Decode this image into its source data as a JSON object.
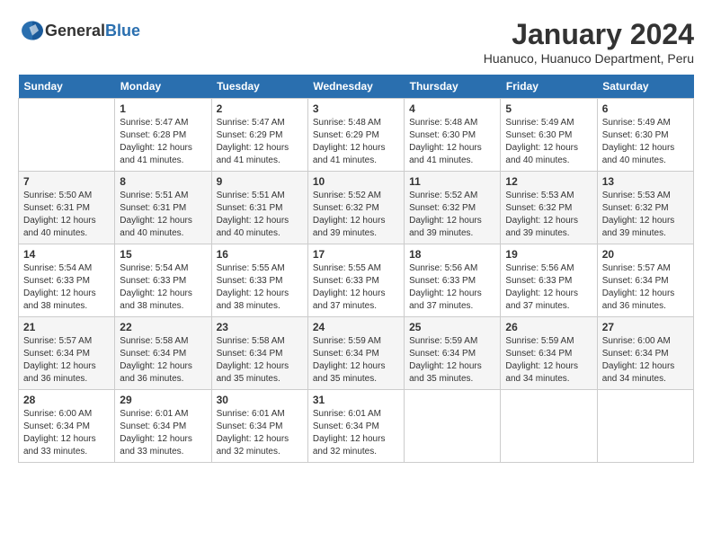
{
  "logo": {
    "general": "General",
    "blue": "Blue"
  },
  "header": {
    "title": "January 2024",
    "subtitle": "Huanuco, Huanuco Department, Peru"
  },
  "days_of_week": [
    "Sunday",
    "Monday",
    "Tuesday",
    "Wednesday",
    "Thursday",
    "Friday",
    "Saturday"
  ],
  "weeks": [
    [
      {
        "day": "",
        "info": ""
      },
      {
        "day": "1",
        "info": "Sunrise: 5:47 AM\nSunset: 6:28 PM\nDaylight: 12 hours\nand 41 minutes."
      },
      {
        "day": "2",
        "info": "Sunrise: 5:47 AM\nSunset: 6:29 PM\nDaylight: 12 hours\nand 41 minutes."
      },
      {
        "day": "3",
        "info": "Sunrise: 5:48 AM\nSunset: 6:29 PM\nDaylight: 12 hours\nand 41 minutes."
      },
      {
        "day": "4",
        "info": "Sunrise: 5:48 AM\nSunset: 6:30 PM\nDaylight: 12 hours\nand 41 minutes."
      },
      {
        "day": "5",
        "info": "Sunrise: 5:49 AM\nSunset: 6:30 PM\nDaylight: 12 hours\nand 40 minutes."
      },
      {
        "day": "6",
        "info": "Sunrise: 5:49 AM\nSunset: 6:30 PM\nDaylight: 12 hours\nand 40 minutes."
      }
    ],
    [
      {
        "day": "7",
        "info": "Sunrise: 5:50 AM\nSunset: 6:31 PM\nDaylight: 12 hours\nand 40 minutes."
      },
      {
        "day": "8",
        "info": "Sunrise: 5:51 AM\nSunset: 6:31 PM\nDaylight: 12 hours\nand 40 minutes."
      },
      {
        "day": "9",
        "info": "Sunrise: 5:51 AM\nSunset: 6:31 PM\nDaylight: 12 hours\nand 40 minutes."
      },
      {
        "day": "10",
        "info": "Sunrise: 5:52 AM\nSunset: 6:32 PM\nDaylight: 12 hours\nand 39 minutes."
      },
      {
        "day": "11",
        "info": "Sunrise: 5:52 AM\nSunset: 6:32 PM\nDaylight: 12 hours\nand 39 minutes."
      },
      {
        "day": "12",
        "info": "Sunrise: 5:53 AM\nSunset: 6:32 PM\nDaylight: 12 hours\nand 39 minutes."
      },
      {
        "day": "13",
        "info": "Sunrise: 5:53 AM\nSunset: 6:32 PM\nDaylight: 12 hours\nand 39 minutes."
      }
    ],
    [
      {
        "day": "14",
        "info": "Sunrise: 5:54 AM\nSunset: 6:33 PM\nDaylight: 12 hours\nand 38 minutes."
      },
      {
        "day": "15",
        "info": "Sunrise: 5:54 AM\nSunset: 6:33 PM\nDaylight: 12 hours\nand 38 minutes."
      },
      {
        "day": "16",
        "info": "Sunrise: 5:55 AM\nSunset: 6:33 PM\nDaylight: 12 hours\nand 38 minutes."
      },
      {
        "day": "17",
        "info": "Sunrise: 5:55 AM\nSunset: 6:33 PM\nDaylight: 12 hours\nand 37 minutes."
      },
      {
        "day": "18",
        "info": "Sunrise: 5:56 AM\nSunset: 6:33 PM\nDaylight: 12 hours\nand 37 minutes."
      },
      {
        "day": "19",
        "info": "Sunrise: 5:56 AM\nSunset: 6:33 PM\nDaylight: 12 hours\nand 37 minutes."
      },
      {
        "day": "20",
        "info": "Sunrise: 5:57 AM\nSunset: 6:34 PM\nDaylight: 12 hours\nand 36 minutes."
      }
    ],
    [
      {
        "day": "21",
        "info": "Sunrise: 5:57 AM\nSunset: 6:34 PM\nDaylight: 12 hours\nand 36 minutes."
      },
      {
        "day": "22",
        "info": "Sunrise: 5:58 AM\nSunset: 6:34 PM\nDaylight: 12 hours\nand 36 minutes."
      },
      {
        "day": "23",
        "info": "Sunrise: 5:58 AM\nSunset: 6:34 PM\nDaylight: 12 hours\nand 35 minutes."
      },
      {
        "day": "24",
        "info": "Sunrise: 5:59 AM\nSunset: 6:34 PM\nDaylight: 12 hours\nand 35 minutes."
      },
      {
        "day": "25",
        "info": "Sunrise: 5:59 AM\nSunset: 6:34 PM\nDaylight: 12 hours\nand 35 minutes."
      },
      {
        "day": "26",
        "info": "Sunrise: 5:59 AM\nSunset: 6:34 PM\nDaylight: 12 hours\nand 34 minutes."
      },
      {
        "day": "27",
        "info": "Sunrise: 6:00 AM\nSunset: 6:34 PM\nDaylight: 12 hours\nand 34 minutes."
      }
    ],
    [
      {
        "day": "28",
        "info": "Sunrise: 6:00 AM\nSunset: 6:34 PM\nDaylight: 12 hours\nand 33 minutes."
      },
      {
        "day": "29",
        "info": "Sunrise: 6:01 AM\nSunset: 6:34 PM\nDaylight: 12 hours\nand 33 minutes."
      },
      {
        "day": "30",
        "info": "Sunrise: 6:01 AM\nSunset: 6:34 PM\nDaylight: 12 hours\nand 32 minutes."
      },
      {
        "day": "31",
        "info": "Sunrise: 6:01 AM\nSunset: 6:34 PM\nDaylight: 12 hours\nand 32 minutes."
      },
      {
        "day": "",
        "info": ""
      },
      {
        "day": "",
        "info": ""
      },
      {
        "day": "",
        "info": ""
      }
    ]
  ]
}
